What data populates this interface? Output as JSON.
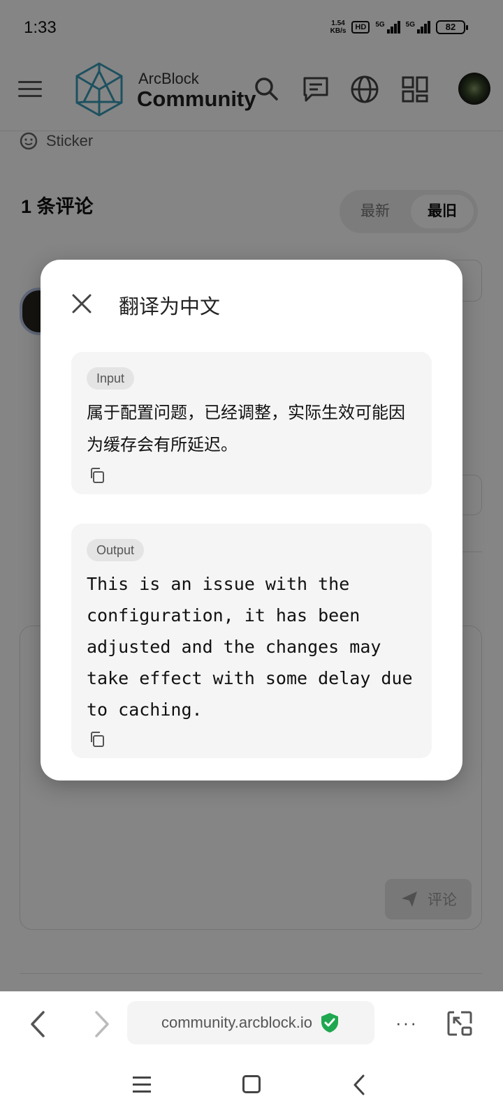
{
  "status_bar": {
    "time": "1:33",
    "speed_value": "1.54",
    "speed_unit": "KB/s",
    "hd_label": "HD",
    "network_1": "5G",
    "network_2": "5G",
    "battery": "82"
  },
  "header": {
    "brand_top": "ArcBlock",
    "brand_main": "Community",
    "icons": [
      "menu-icon",
      "search-icon",
      "chat-icon",
      "globe-icon",
      "grid-icon"
    ],
    "accent_color": "#3a9bb8"
  },
  "page": {
    "sticker_label": "Sticker",
    "comment_count": "1 条评论",
    "sort_options": [
      "最新",
      "最旧"
    ],
    "sort_selected": "最旧",
    "submit_label": "评论"
  },
  "dialog": {
    "title": "翻译为中文",
    "input_label": "Input",
    "input_text": "属于配置问题，已经调整，实际生效可能因为缓存会有所延迟。",
    "output_label": "Output",
    "output_text": "This is an issue with the configuration, it has been adjusted and the changes may take effect with some delay due to caching."
  },
  "browser": {
    "url": "community.arcblock.io",
    "more_label": "···",
    "secure_color": "#1fa84f"
  }
}
